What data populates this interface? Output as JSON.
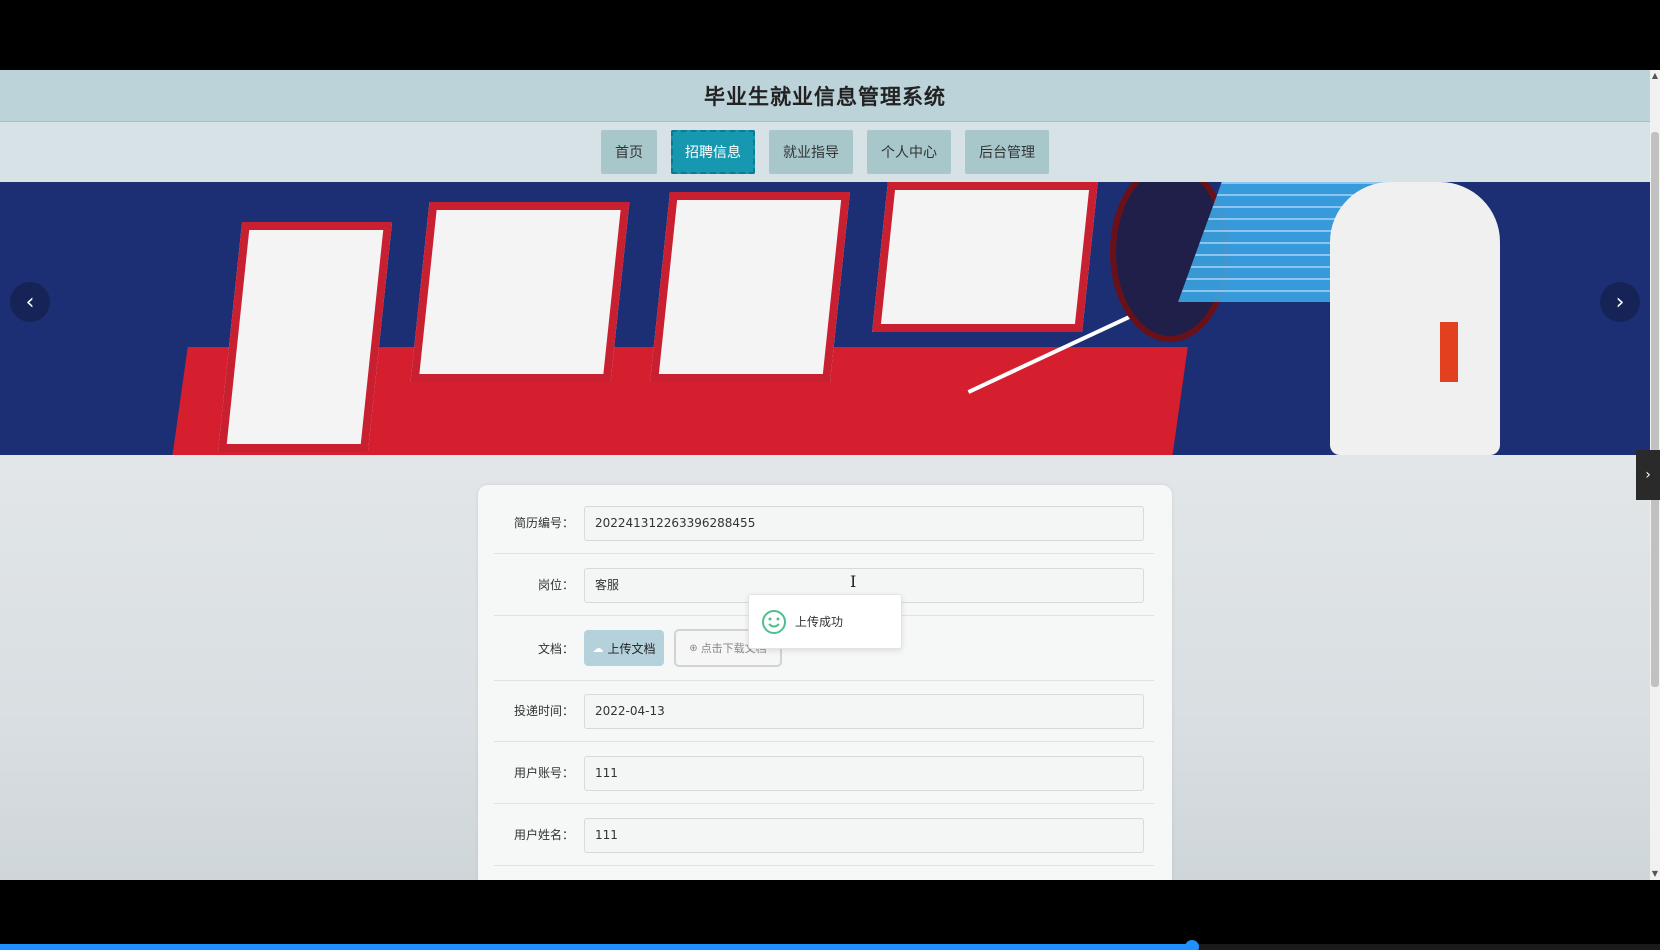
{
  "site": {
    "title": "毕业生就业信息管理系统"
  },
  "nav": {
    "items": [
      {
        "label": "首页"
      },
      {
        "label": "招聘信息"
      },
      {
        "label": "就业指导"
      },
      {
        "label": "个人中心"
      },
      {
        "label": "后台管理"
      }
    ],
    "active_index": 1
  },
  "banner": {
    "prev_icon": "chevron-left-icon",
    "next_icon": "chevron-right-icon"
  },
  "form": {
    "resume_no": {
      "label": "简历编号：",
      "value": "202241312263396288455"
    },
    "position": {
      "label": "岗位：",
      "value": "客服"
    },
    "document": {
      "label": "文档：",
      "upload_label": "上传文档",
      "download_label": "点击下载文档"
    },
    "submit_time": {
      "label": "投递时间：",
      "value": "2022-04-13"
    },
    "user_account": {
      "label": "用户账号：",
      "value": "111"
    },
    "user_name": {
      "label": "用户姓名：",
      "value": "111"
    }
  },
  "toast": {
    "message": "上传成功",
    "icon": "smile-icon"
  },
  "video": {
    "progress": 0.718
  },
  "colors": {
    "accent": "#1598b0",
    "header": "#bdd3da",
    "nav": "#a8c7ca"
  }
}
